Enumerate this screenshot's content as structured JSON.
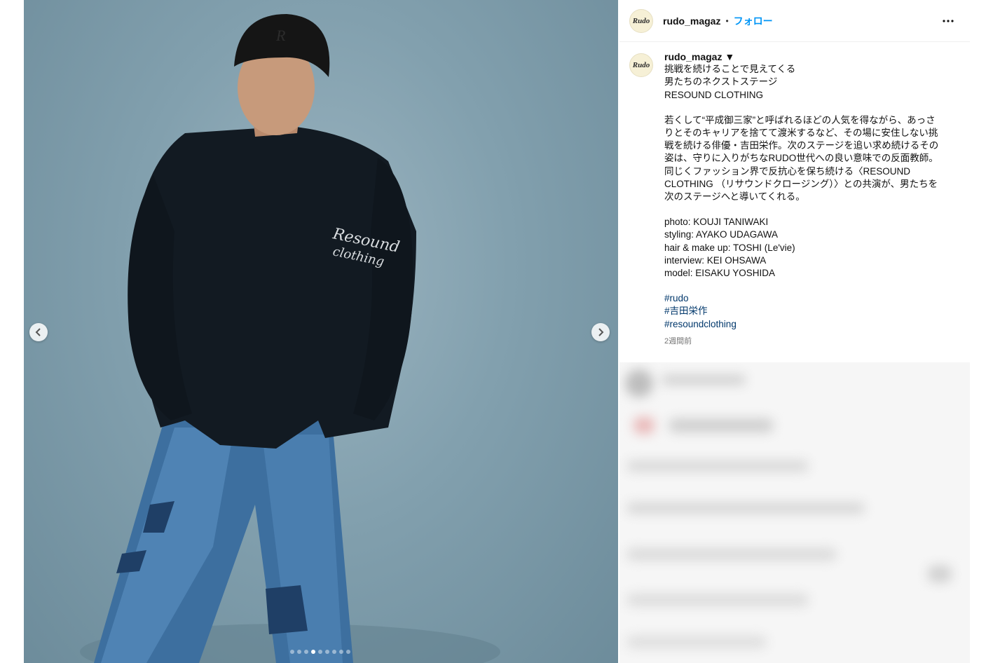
{
  "post": {
    "username": "rudo_magaz",
    "avatar_text": "Rudo",
    "follow_label": "フォロー",
    "separator": "•",
    "more_icon": "more-horizontal-icon"
  },
  "caption": {
    "username": "rudo_magaz ▼",
    "title_lines": [
      "挑戦を続けることで見えてくる",
      "男たちのネクストステージ",
      "RESOUND CLOTHING"
    ],
    "body": "若くして“平成御三家”と呼ばれるほどの人気を得ながら、あっさりとそのキャリアを捨てて渡米するなど、その場に安住しない挑戦を続ける俳優・吉田栄作。次のステージを追い求め続けるその姿は、守りに入りがちなRUDO世代への良い意味での反面教師。同じくファッション界で反抗心を保ち続ける〈RESOUND CLOTHING （リサウンドクロージング）〉との共演が、男たちを次のステージへと導いてくれる。",
    "credits": [
      "photo: KOUJI TANIWAKI",
      "styling: AYAKO UDAGAWA",
      "hair & make up: TOSHI (Le'vie)",
      "interview: KEI OHSAWA",
      "model: EISAKU YOSHIDA"
    ],
    "hashtags": [
      "#rudo",
      "#吉田栄作",
      "#resoundclothing"
    ],
    "timestamp": "2週間前"
  },
  "media": {
    "carousel_count": 9,
    "active_index": 3,
    "sweatshirt_print": [
      "Resound",
      "clothing"
    ]
  },
  "colors": {
    "link": "#0095f6",
    "hashtag": "#00376b",
    "backdrop": "#82a0ae"
  }
}
